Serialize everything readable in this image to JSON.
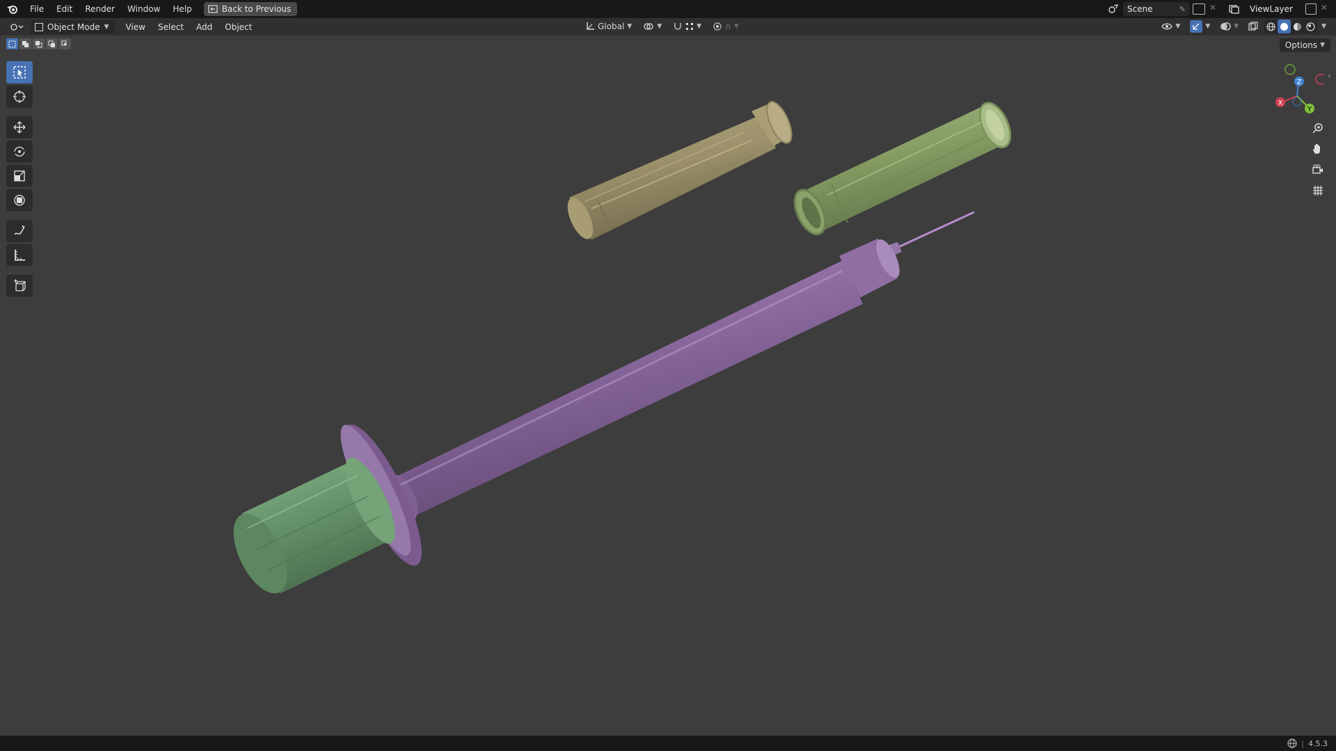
{
  "topbar": {
    "menu": [
      "File",
      "Edit",
      "Render",
      "Window",
      "Help"
    ],
    "back_button": "Back to Previous",
    "scene": "Scene",
    "view_layer": "ViewLayer"
  },
  "header": {
    "mode": "Object Mode",
    "menus": [
      "View",
      "Select",
      "Add",
      "Object"
    ],
    "transform_orientation": "Global"
  },
  "viewport": {
    "options_label": "Options",
    "gizmo_axes": {
      "x": "X",
      "y": "Y",
      "z": "Z"
    }
  },
  "statusbar": {
    "version": "4.5.3"
  },
  "colors": {
    "accent": "#4772b3",
    "viewport_bg": "#3d3d3d",
    "cap_tan": "#9a8f69",
    "cap_green": "#849b62",
    "barrel_purple": "#8c6aa0",
    "plunger_green": "#66946a"
  },
  "icons": {
    "toolbar": [
      "select-box-icon",
      "cursor-icon",
      "move-icon",
      "rotate-icon",
      "scale-icon",
      "transform-icon",
      "annotate-icon",
      "measure-icon",
      "add-cube-icon"
    ],
    "nav": [
      "zoom-icon",
      "pan-hand-icon",
      "camera-view-icon",
      "grid-ortho-icon"
    ]
  }
}
